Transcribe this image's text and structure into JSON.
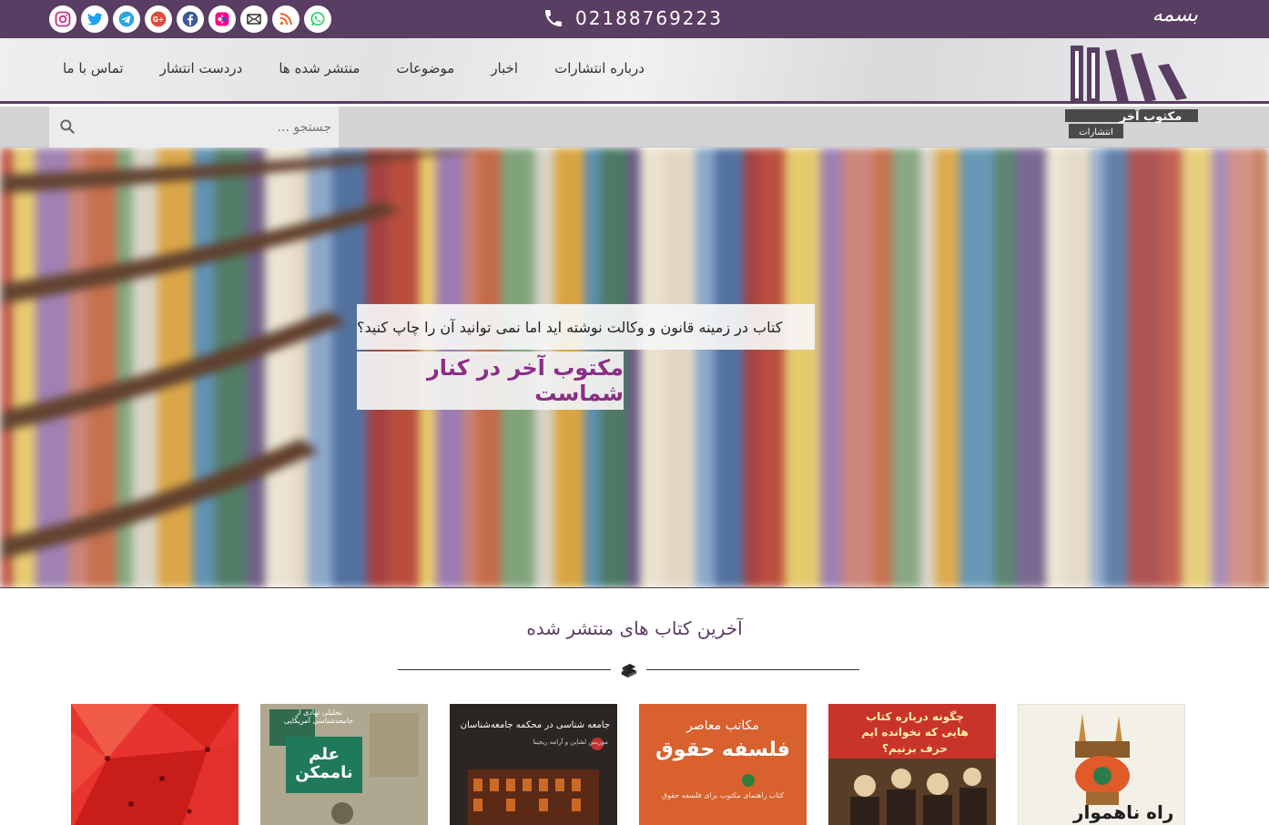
{
  "topbar": {
    "phone": "02188769223",
    "bismillah": "بسمه",
    "socials": [
      "instagram-icon",
      "twitter-icon",
      "telegram-icon",
      "google-plus-icon",
      "facebook-icon",
      "flickr-icon",
      "email-icon",
      "rss-icon",
      "whatsapp-icon"
    ]
  },
  "nav": {
    "items": [
      {
        "label": "درباره انتشارات"
      },
      {
        "label": "اخبار"
      },
      {
        "label": "موضوعات"
      },
      {
        "label": "منتشر شده ها"
      },
      {
        "label": "دردست انتشار"
      },
      {
        "label": "تماس با ما"
      }
    ]
  },
  "logo": {
    "name": "مکتوب آخر",
    "sub": "انتشارات"
  },
  "search": {
    "placeholder": "جستجو ..."
  },
  "hero": {
    "question": "کتاب در زمینه قانون و وکالت نوشته اید اما نمی توانید آن را چاپ کنید؟",
    "tagline": "مکتوب آخر در کنار شماست"
  },
  "latest": {
    "title": "آخرین کتاب های منتشر شده",
    "books": [
      {
        "title": ""
      },
      {
        "title": "علم ناممکن",
        "subtitle": "تحلیلی نهادی از جامعه‌شناسی آمریکایی"
      },
      {
        "title": "جامعه شناسی در محکمه جامعه‌شناسان",
        "subtitle": "موریس لشاین و آرامه ریجینا"
      },
      {
        "title": "فلسفه حقوق",
        "subtitle": "مکاتب معاصر",
        "note": "کتاب راهنمای مکتوب برای فلسفه حقوق"
      },
      {
        "title": "چگونه درباره کتاب هایی که نخوانده ایم حرف بزنیم؟"
      },
      {
        "title": "راه ناهموار"
      }
    ]
  },
  "colors": {
    "brand": "#5a3d62",
    "accent": "#8a2f86"
  }
}
